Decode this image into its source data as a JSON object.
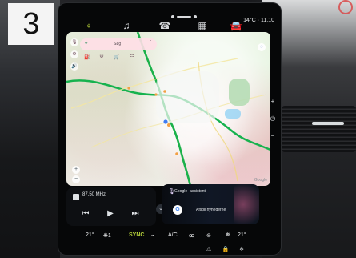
{
  "photo_label": "3",
  "status_bar": {
    "temperature_time": "14°C · 11.10"
  },
  "top_nav": {
    "items": [
      {
        "icon": "location-pin-icon",
        "active": true
      },
      {
        "icon": "music-note-icon",
        "active": false
      },
      {
        "icon": "phone-icon",
        "active": false
      },
      {
        "icon": "apps-grid-icon",
        "active": false
      },
      {
        "icon": "car-icon",
        "active": false
      }
    ]
  },
  "map": {
    "search_text": "Søg",
    "google_text": "Google"
  },
  "media": {
    "station": "87,50 MHz",
    "prev_symbol": "⏮",
    "play_symbol": "▶",
    "next_symbol": "⏭"
  },
  "assistant": {
    "title": "Google- assistent",
    "action": "Afspil nyhederne"
  },
  "climate": {
    "left_temp": "21",
    "fan_level": "1",
    "sync": "SYNC",
    "ac": "A/C",
    "right_temp": "21"
  },
  "colors": {
    "active_accent": "#b7d23b",
    "screen_background": "#060708",
    "assistant_gradient_accent": "#f870a4"
  }
}
